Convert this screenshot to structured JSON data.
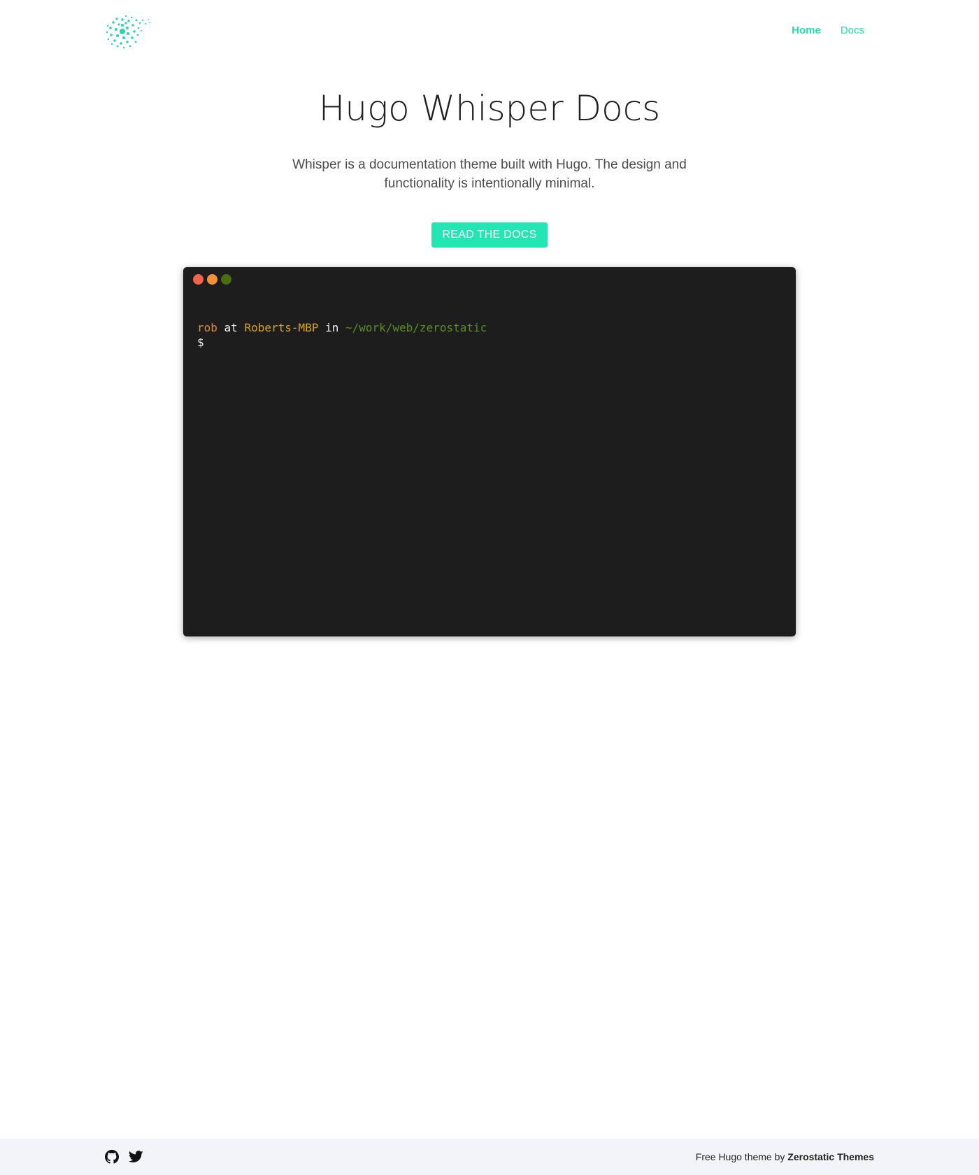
{
  "header": {
    "logo_icon": "dotted-swirl-logo-icon",
    "nav": [
      {
        "label": "Home",
        "active": true
      },
      {
        "label": "Docs",
        "active": false
      }
    ]
  },
  "hero": {
    "title": "Hugo Whisper Docs",
    "subtitle": "Whisper is a documentation theme built with Hugo. The design and functionality is intentionally minimal.",
    "cta_label": "READ THE DOCS"
  },
  "terminal": {
    "dots": [
      "#f0634c",
      "#f29139",
      "#4a6d10"
    ],
    "prompt": {
      "user": "rob",
      "at": "at",
      "host": "Roberts-MBP",
      "in": "in",
      "path": "~/work/web/zerostatic",
      "symbol": "$"
    }
  },
  "footer": {
    "icons": [
      "github-icon",
      "twitter-icon"
    ],
    "credit_prefix": "Free Hugo theme by",
    "credit_brand": "Zerostatic Themes"
  },
  "colors": {
    "accent": "#23e6b4",
    "nav_link": "#1fe0ac",
    "terminal_bg": "#1d1d1d",
    "footer_bg": "#f2f4f9"
  }
}
